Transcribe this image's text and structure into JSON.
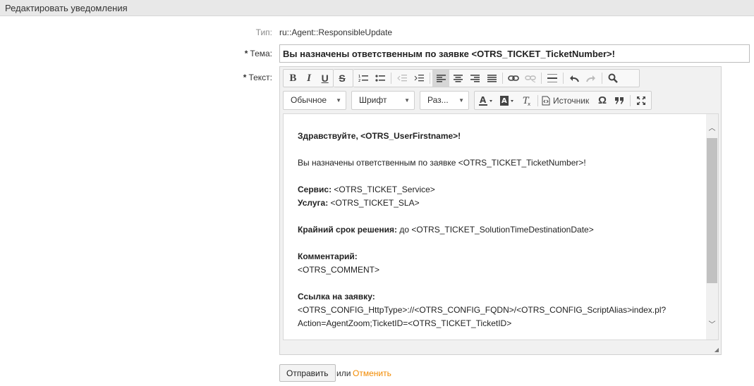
{
  "header": {
    "title": "Редактировать уведомления"
  },
  "form": {
    "type_label": "Тип:",
    "type_value": "ru::Agent::ResponsibleUpdate",
    "subject_label": "Тема:",
    "subject_value": "Вы назначены ответственным по заявке <OTRS_TICKET_TicketNumber>!",
    "text_label": "Текст:",
    "required_mark": "*"
  },
  "toolbar": {
    "row1": [
      "bold",
      "italic",
      "underline",
      "strike",
      "numbered-list",
      "bullet-list",
      "outdent",
      "indent",
      "align-left",
      "align-center",
      "align-right",
      "justify",
      "link",
      "unlink",
      "horizontal-rule",
      "undo",
      "redo",
      "find"
    ],
    "format_label": "Обычное",
    "font_label": "Шрифт",
    "size_label": "Раз...",
    "source_label": "Источник",
    "glyphs": {
      "bold": "B",
      "italic": "I",
      "underline": "U",
      "strike": "S",
      "omega": "Ω"
    }
  },
  "body": {
    "greeting": "Здравствуйте, <OTRS_UserFirstname>!",
    "assigned": "Вы назначены ответственным по заявке <OTRS_TICKET_TicketNumber>!",
    "service_label": "Сервис:",
    "service_value": " <OTRS_TICKET_Service>",
    "sla_label": "Услуга:",
    "sla_value": " <OTRS_TICKET_SLA>",
    "deadline_label": "Крайний срок решения:",
    "deadline_value": " до <OTRS_TICKET_SolutionTimeDestinationDate>",
    "comment_label": "Комментарий:",
    "comment_value": "<OTRS_COMMENT>",
    "link_label": "Ссылка на заявку:",
    "link_line1": "<OTRS_CONFIG_HttpType>://<OTRS_CONFIG_FQDN>/<OTRS_CONFIG_ScriptAlias>index.pl?",
    "link_line2": "Action=AgentZoom;TicketID=<OTRS_TICKET_TicketID>"
  },
  "actions": {
    "submit_label": "Отправить",
    "or_label": "или",
    "cancel_label": "Отменить"
  },
  "colors": {
    "cancel_link": "#f28a00",
    "header_bg": "#e8e8e8"
  }
}
